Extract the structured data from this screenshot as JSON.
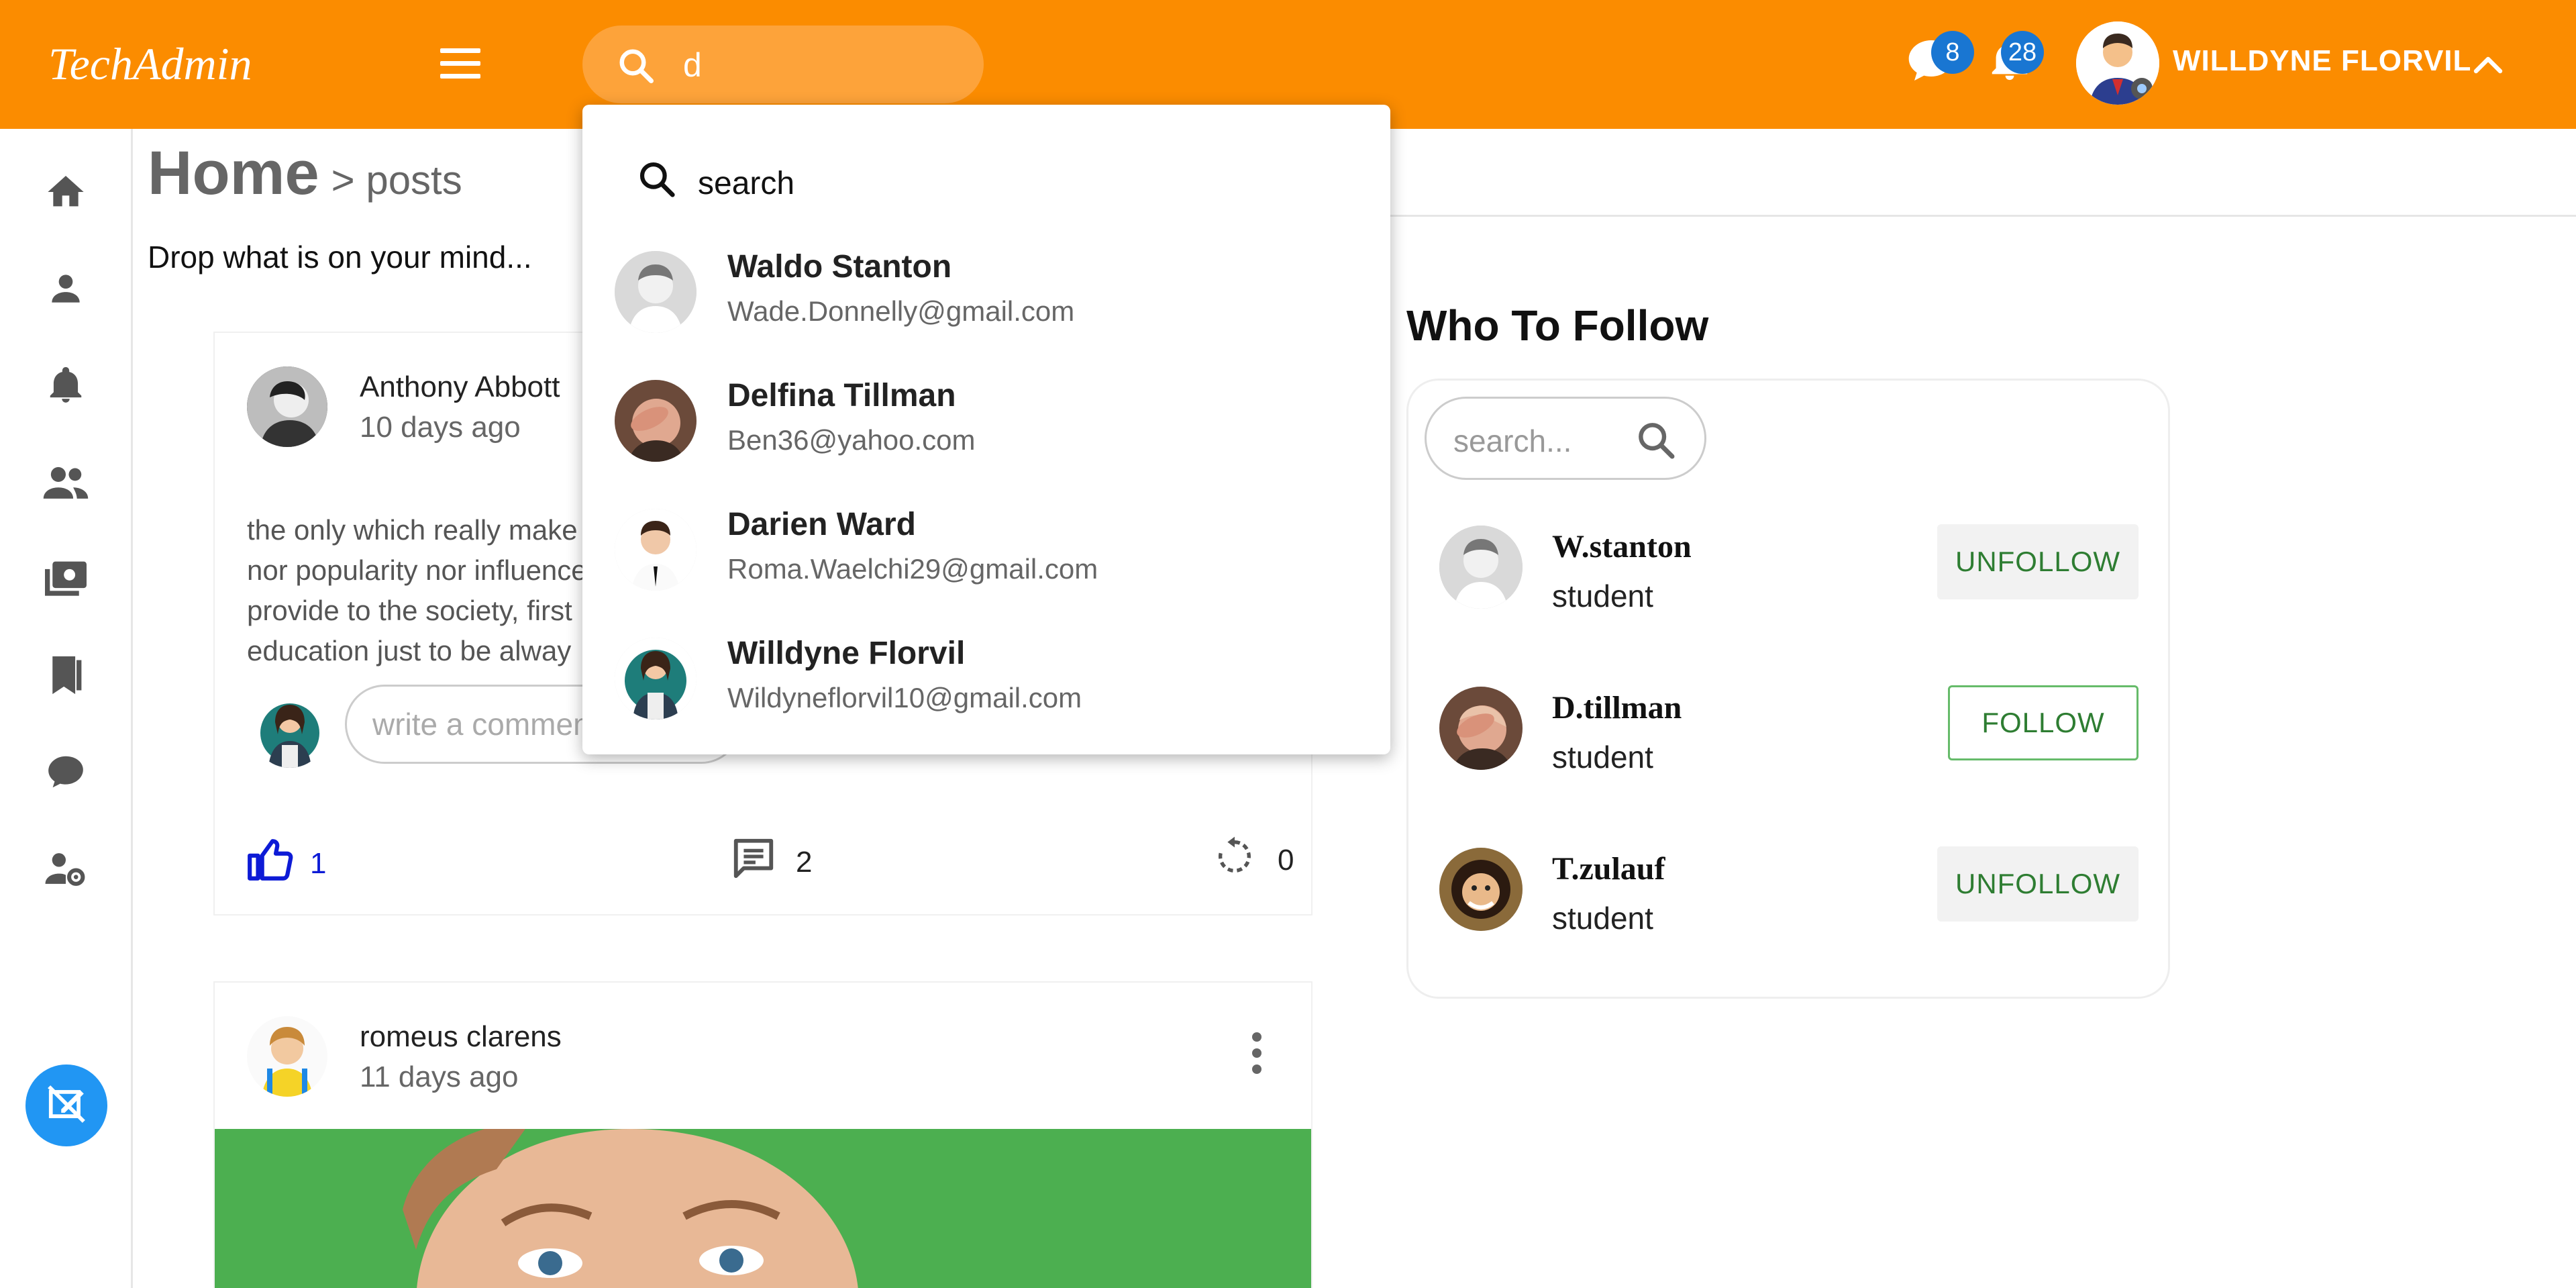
{
  "app": {
    "brand": "TechAdmin"
  },
  "header": {
    "search_value": "d",
    "messages_count": "8",
    "notifications_count": "28",
    "user_name": "WILLDYNE FLORVIL"
  },
  "breadcrumb": {
    "home": "Home",
    "current": "> posts"
  },
  "composer": {
    "prompt": "Drop what is on your mind..."
  },
  "posts": [
    {
      "author": "Anthony Abbott",
      "time": "10 days ago",
      "text_lines": [
        "the only which really make",
        "nor popularity nor influence",
        "provide to the society, first",
        "education just to be alway"
      ],
      "comment_placeholder": "write a comment",
      "likes": "1",
      "comments": "2",
      "shares": "0"
    },
    {
      "author": "romeus clarens",
      "time": "11 days ago"
    }
  ],
  "who_to_follow": {
    "title": "Who To Follow",
    "search_placeholder": "search...",
    "people": [
      {
        "name": "W.stanton",
        "role": "student",
        "action": "UNFOLLOW"
      },
      {
        "name": "D.tillman",
        "role": "student",
        "action": "FOLLOW"
      },
      {
        "name": "T.zulauf",
        "role": "student",
        "action": "UNFOLLOW"
      }
    ]
  },
  "dropdown": {
    "search_label": "search",
    "results": [
      {
        "name": "Waldo Stanton",
        "email": "Wade.Donnelly@gmail.com"
      },
      {
        "name": "Delfina Tillman",
        "email": "Ben36@yahoo.com"
      },
      {
        "name": "Darien Ward",
        "email": "Roma.Waelchi29@gmail.com"
      },
      {
        "name": "Willdyne Florvil",
        "email": "Wildyneflorvil10@gmail.com"
      }
    ]
  },
  "colors": {
    "header_bg": "#fb8c00",
    "accent_blue": "#2196f3",
    "badge_blue": "#1976d2",
    "follow_green": "#2e7d32",
    "like_blue": "#0d1bd6"
  },
  "icons": {
    "sidebar": [
      "home-icon",
      "person-icon",
      "bell-icon",
      "group-icon",
      "photos-icon",
      "bookmarks-icon",
      "chat-icon",
      "user-settings-icon",
      "edit-post-icon"
    ]
  }
}
